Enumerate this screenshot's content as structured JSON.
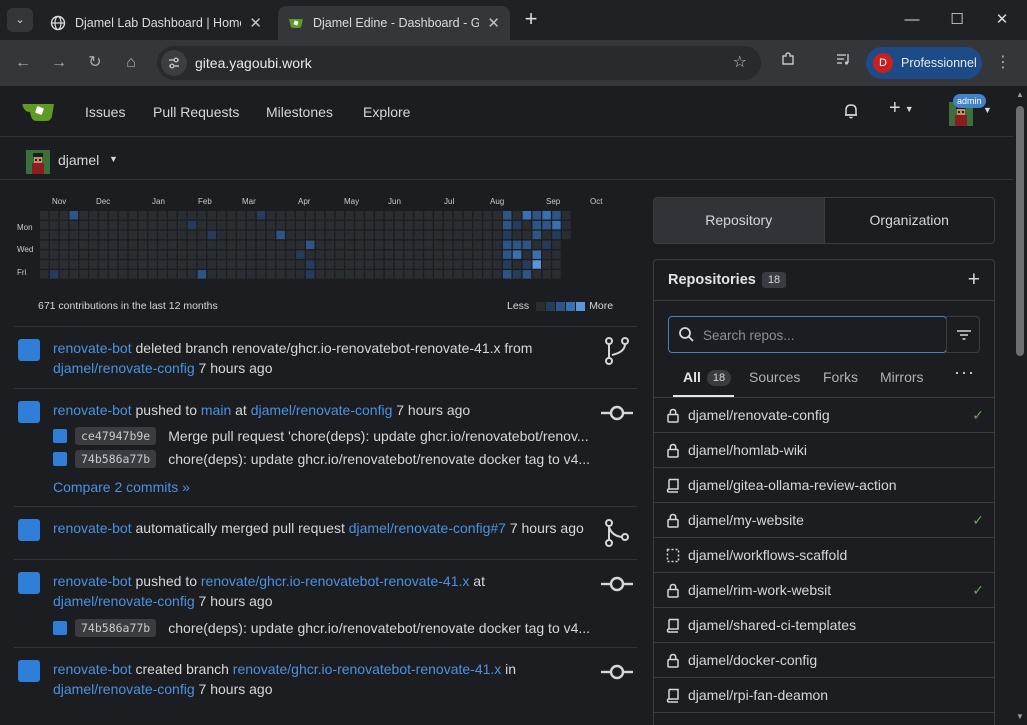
{
  "browser": {
    "tabs": [
      {
        "title": "Djamel Lab Dashboard | HomeL"
      },
      {
        "title": "Djamel Edine - Dashboard - Gite"
      }
    ],
    "address": "gitea.yagoubi.work",
    "profile": {
      "initial": "D",
      "label": "Professionnel"
    },
    "window_controls": [
      "minimize",
      "maximize",
      "close"
    ]
  },
  "nav": {
    "links": [
      "Issues",
      "Pull Requests",
      "Milestones",
      "Explore"
    ],
    "admin_badge": "admin"
  },
  "context": {
    "user": "djamel"
  },
  "heatmap": {
    "months": [
      "Nov",
      "Dec",
      "Jan",
      "Feb",
      "Mar",
      "Apr",
      "May",
      "Jun",
      "Jul",
      "Aug",
      "Sep",
      "Oct"
    ],
    "weekdays": [
      "Mon",
      "Wed",
      "Fri"
    ],
    "summary": "671 contributions in the last 12 months",
    "legend_less": "Less",
    "legend_more": "More",
    "colors": [
      "#2a2d32",
      "#253c5c",
      "#2d5687",
      "#3a6fb0",
      "#5c95d8"
    ]
  },
  "feed": [
    {
      "actor": "renovate-bot",
      "parts": [
        {
          "t": " deleted branch renovate/ghcr.io-renovatebot-renovate-41.x from"
        }
      ],
      "line2": [
        {
          "t": "djamel/renovate-config",
          "link": true
        },
        {
          "t": " 7 hours ago"
        }
      ],
      "type": "branch-icon"
    },
    {
      "actor": "renovate-bot",
      "parts": [
        {
          "t": " pushed to "
        },
        {
          "t": "main",
          "link": true
        },
        {
          "t": " at "
        },
        {
          "t": "djamel/renovate-config",
          "link": true
        },
        {
          "t": " 7 hours ago"
        }
      ],
      "commits": [
        {
          "sha": "ce47947b9e",
          "msg": "Merge pull request 'chore(deps): update ghcr.io/renovatebot/renov..."
        },
        {
          "sha": "74b586a77b",
          "msg": "chore(deps): update ghcr.io/renovatebot/renovate docker tag to v4..."
        }
      ],
      "compare": "Compare 2 commits »",
      "type": "commit-icon"
    },
    {
      "actor": "renovate-bot",
      "parts": [
        {
          "t": " automatically merged pull request "
        },
        {
          "t": "djamel/renovate-config#7",
          "link": true
        },
        {
          "t": " 7 hours ago"
        }
      ],
      "type": "merge-icon"
    },
    {
      "actor": "renovate-bot",
      "parts": [
        {
          "t": " pushed to "
        },
        {
          "t": "renovate/ghcr.io-renovatebot-renovate-41.x",
          "link": true
        },
        {
          "t": " at"
        }
      ],
      "line2": [
        {
          "t": "djamel/renovate-config",
          "link": true
        },
        {
          "t": " 7 hours ago"
        }
      ],
      "commits": [
        {
          "sha": "74b586a77b",
          "msg": "chore(deps): update ghcr.io/renovatebot/renovate docker tag to v4..."
        }
      ],
      "type": "commit-icon"
    },
    {
      "actor": "renovate-bot",
      "parts": [
        {
          "t": " created branch "
        },
        {
          "t": "renovate/ghcr.io-renovatebot-renovate-41.x",
          "link": true
        },
        {
          "t": " in"
        }
      ],
      "line2": [
        {
          "t": "djamel/renovate-config",
          "link": true
        },
        {
          "t": " 7 hours ago"
        }
      ],
      "type": "commit-icon"
    }
  ],
  "panel": {
    "switch": [
      "Repository",
      "Organization"
    ],
    "title": "Repositories",
    "count": "18",
    "search_placeholder": "Search repos...",
    "tabs": [
      "All",
      "Sources",
      "Forks",
      "Mirrors"
    ],
    "all_count": "18",
    "repos": [
      {
        "name": "djamel/renovate-config",
        "icon": "lock-icon",
        "check": true
      },
      {
        "name": "djamel/homlab-wiki",
        "icon": "lock-icon",
        "check": false
      },
      {
        "name": "djamel/gitea-ollama-review-action",
        "icon": "repo-icon",
        "check": false
      },
      {
        "name": "djamel/my-website",
        "icon": "lock-icon",
        "check": true
      },
      {
        "name": "djamel/workflows-scaffold",
        "icon": "template-icon",
        "check": false
      },
      {
        "name": "djamel/rim-work-websit",
        "icon": "lock-icon",
        "check": true
      },
      {
        "name": "djamel/shared-ci-templates",
        "icon": "repo-icon",
        "check": false
      },
      {
        "name": "djamel/docker-config",
        "icon": "lock-icon",
        "check": false
      },
      {
        "name": "djamel/rpi-fan-deamon",
        "icon": "repo-icon",
        "check": false
      }
    ]
  }
}
